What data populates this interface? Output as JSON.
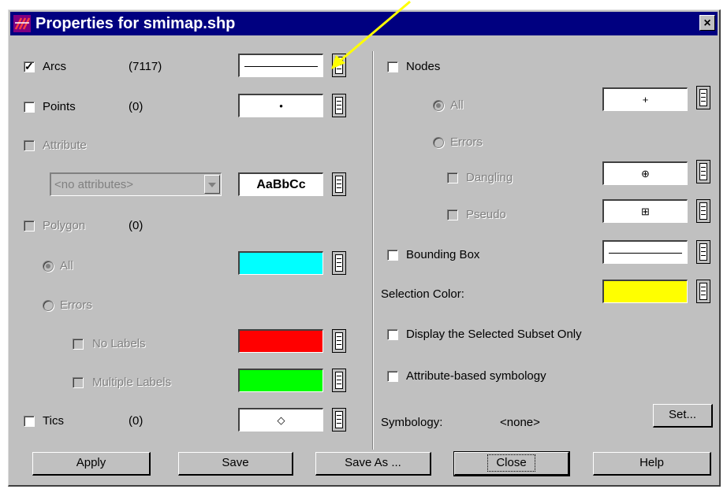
{
  "window": {
    "title": "Properties for smimap.shp",
    "close_glyph": "×"
  },
  "left": {
    "arcs": {
      "label": "Arcs",
      "count": "(7117)",
      "checked": true
    },
    "points": {
      "label": "Points",
      "count": "(0)",
      "symbol": "•"
    },
    "attribute": {
      "label": "Attribute",
      "combo_value": "<no attributes>",
      "sample": "AaBbCc"
    },
    "polygon": {
      "label": "Polygon",
      "count": "(0)"
    },
    "poly_all": {
      "label": "All",
      "color": "#00ffff"
    },
    "poly_errors": {
      "label": "Errors"
    },
    "no_labels": {
      "label": "No Labels",
      "color": "#ff0000"
    },
    "multiple_labels": {
      "label": "Multiple Labels",
      "color": "#00ff00"
    },
    "tics": {
      "label": "Tics",
      "count": "(0)",
      "symbol": "◇"
    }
  },
  "right": {
    "nodes": {
      "label": "Nodes"
    },
    "all": {
      "label": "All",
      "symbol": "+"
    },
    "errors": {
      "label": "Errors"
    },
    "dangling": {
      "label": "Dangling",
      "symbol": "⊕"
    },
    "pseudo": {
      "label": "Pseudo",
      "symbol": "⊞"
    },
    "bounding_box": {
      "label": "Bounding Box"
    },
    "selection_color": {
      "label": "Selection Color:",
      "color": "#ffff00"
    },
    "display_subset": {
      "label": "Display the Selected Subset Only"
    },
    "attr_symbology": {
      "label": "Attribute-based symbology"
    },
    "symbology": {
      "label": "Symbology:",
      "value": "<none>",
      "set_button": "Set..."
    }
  },
  "buttons": {
    "apply": "Apply",
    "save": "Save",
    "save_as": "Save As ...",
    "close": "Close",
    "help": "Help"
  },
  "annotation": {
    "arrow_color": "#ffff00"
  }
}
